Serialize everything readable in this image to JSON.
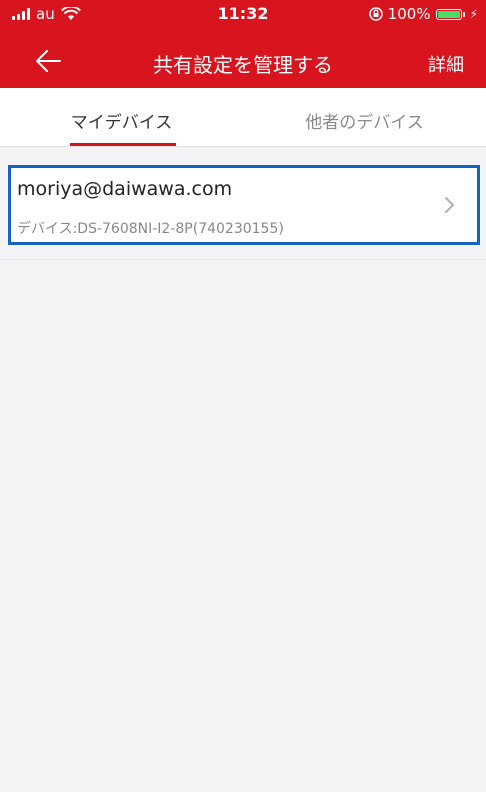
{
  "status_bar": {
    "carrier": "au",
    "time": "11:32",
    "battery": "100%",
    "battery_level": 1.0
  },
  "nav": {
    "title": "共有設定を管理する",
    "detail_label": "詳細"
  },
  "tabs": {
    "mine": "マイデバイス",
    "others": "他者のデバイス"
  },
  "share_list": [
    {
      "email": "moriya@daiwawa.com",
      "device": "デバイス:DS-7608NI-I2-8P(740230155)"
    }
  ],
  "colors": {
    "header": "#d8151f",
    "selection_border": "#1565c0",
    "battery": "#4cd964"
  }
}
